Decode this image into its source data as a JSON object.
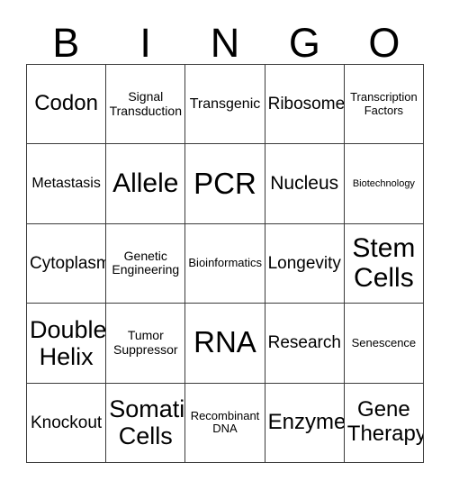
{
  "card": {
    "title_letters": [
      "B",
      "I",
      "N",
      "G",
      "O"
    ],
    "colors": {
      "background": "#ffffff",
      "text": "#000000",
      "grid_line": "#3a3a3a"
    },
    "grid_size": "5x5",
    "cells": [
      [
        {
          "label": "Codon",
          "size": "xl"
        },
        {
          "label": "Signal Transduction",
          "size": "sm"
        },
        {
          "label": "Transgenic",
          "size": "m"
        },
        {
          "label": "Ribosome",
          "size": "ml"
        },
        {
          "label": "Transcription Factors",
          "size": "s"
        }
      ],
      [
        {
          "label": "Metastasis",
          "size": "m"
        },
        {
          "label": "Allele",
          "size": "3xl"
        },
        {
          "label": "PCR",
          "size": "4xl"
        },
        {
          "label": "Nucleus",
          "size": "l"
        },
        {
          "label": "Biotechnology",
          "size": "xs"
        }
      ],
      [
        {
          "label": "Cytoplasm",
          "size": "ml"
        },
        {
          "label": "Genetic Engineering",
          "size": "sm"
        },
        {
          "label": "Bioinformatics",
          "size": "s"
        },
        {
          "label": "Longevity",
          "size": "ml"
        },
        {
          "label": "Stem Cells",
          "size": "3xl"
        }
      ],
      [
        {
          "label": "Double Helix",
          "size": "2xl"
        },
        {
          "label": "Tumor Suppressor",
          "size": "sm"
        },
        {
          "label": "RNA",
          "size": "4xl"
        },
        {
          "label": "Research",
          "size": "ml"
        },
        {
          "label": "Senescence",
          "size": "s"
        }
      ],
      [
        {
          "label": "Knockout",
          "size": "ml"
        },
        {
          "label": "Somatic Cells",
          "size": "2xl"
        },
        {
          "label": "Recombinant DNA",
          "size": "s"
        },
        {
          "label": "Enzyme",
          "size": "xl"
        },
        {
          "label": "Gene Therapy",
          "size": "xl"
        }
      ]
    ]
  }
}
